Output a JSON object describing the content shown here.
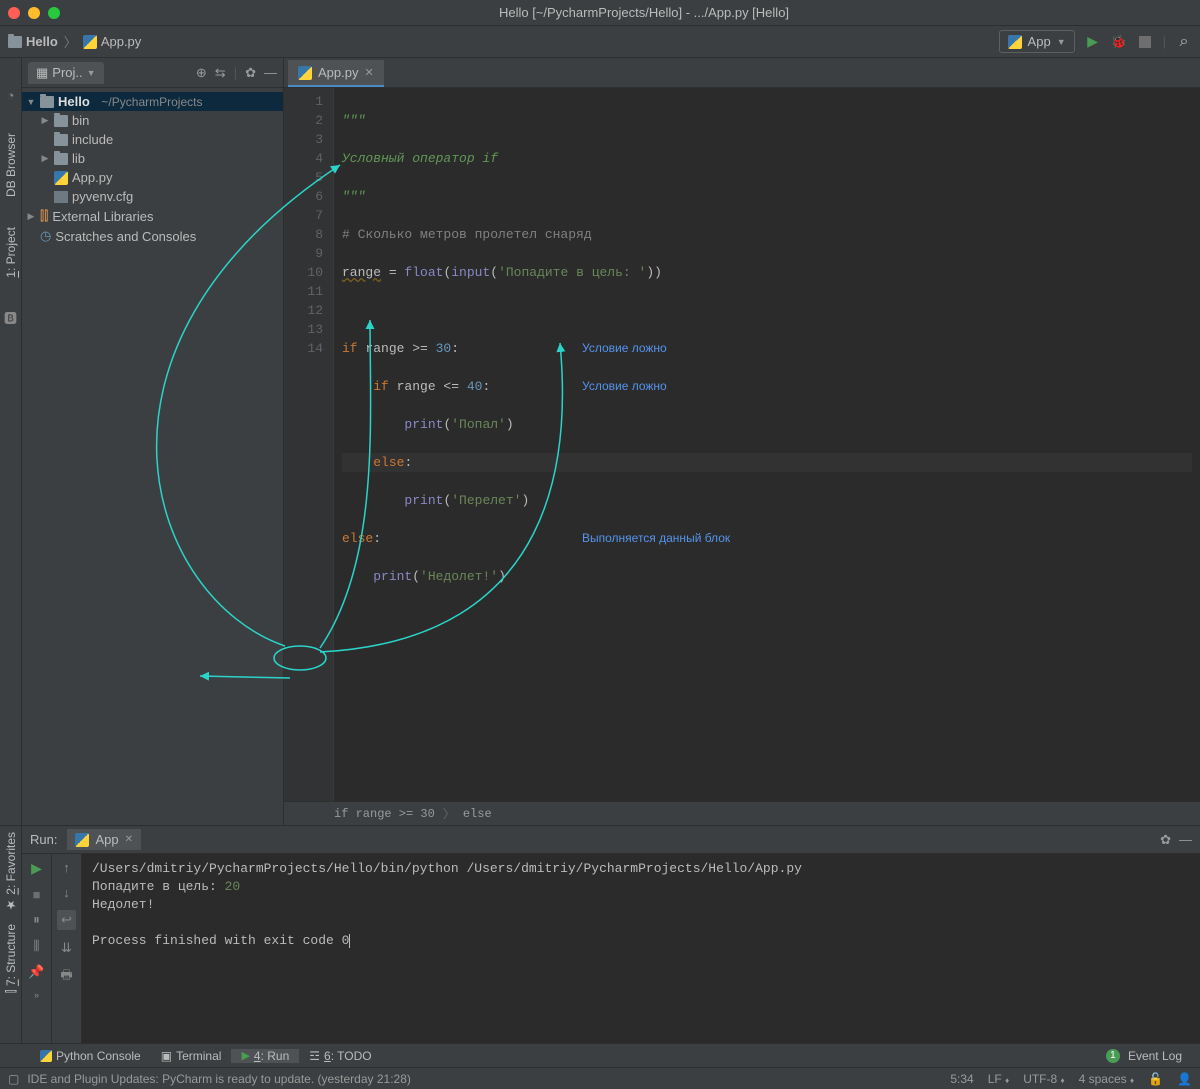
{
  "title": "Hello [~/PycharmProjects/Hello] - .../App.py [Hello]",
  "breadcrumb": {
    "project": "Hello",
    "file": "App.py"
  },
  "toolbar": {
    "run_config": "App"
  },
  "sidebar": {
    "tab": "Proj..",
    "root": {
      "name": "Hello",
      "path": "~/PycharmProjects"
    },
    "items": [
      "bin",
      "include",
      "lib",
      "App.py",
      "pyvenv.cfg"
    ],
    "ext": "External Libraries",
    "scratch": "Scratches and Consoles"
  },
  "editor": {
    "tab": "App.py",
    "lines": {
      "l1": "\"\"\"",
      "l2": "Условный оператор if",
      "l3": "\"\"\"",
      "l4_cmt": "# Сколько метров пролетел снаряд",
      "l5_var": "range",
      "l5_eq": " = ",
      "l5_float": "float",
      "l5_input": "input",
      "l5_str": "'Попадите в цель: '",
      "l7_if": "if",
      "l7_cond": " range >= ",
      "l7_num": "30",
      "l8_if": "if",
      "l8_cond": " range <= ",
      "l8_num": "40",
      "l9_print": "print",
      "l9_str": "'Попал'",
      "l10_else": "else",
      "l11_print": "print",
      "l11_str": "'Перелет'",
      "l12_else": "else",
      "l13_print": "print",
      "l13_str": "'Недолет!'"
    },
    "hints": {
      "h1": "Условие ложно",
      "h2": "Условие ложно",
      "h3": "Выполняется данный блок"
    },
    "crumb1": "if range >= 30",
    "crumb2": "else"
  },
  "run": {
    "title": "Run:",
    "tab": "App",
    "out1": "/Users/dmitriy/PycharmProjects/Hello/bin/python /Users/dmitriy/PycharmProjects/Hello/App.py",
    "out2a": "Попадите в цель: ",
    "out2b": "20",
    "out3": "Недолет!",
    "out4": "Process finished with exit code 0"
  },
  "bottom": {
    "pc": "Python Console",
    "term": "Terminal",
    "run": "4: Run",
    "todo": "6: TODO",
    "evlog": "Event Log"
  },
  "left_btns": {
    "db": "DB Browser",
    "proj": "1: Project",
    "fav": "2: Favorites",
    "struct": "7: Structure"
  },
  "status": {
    "msg": "IDE and Plugin Updates: PyCharm is ready to update. (yesterday 21:28)",
    "pos": "5:34",
    "sep": "LF",
    "enc": "UTF-8",
    "indent": "4 spaces"
  }
}
